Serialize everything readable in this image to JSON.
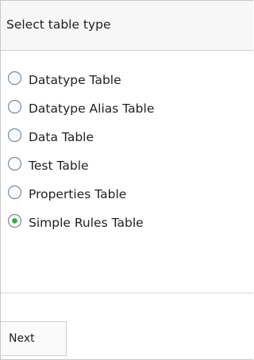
{
  "header": {
    "title": "Select table type"
  },
  "options": [
    {
      "label": "Datatype Table",
      "selected": false
    },
    {
      "label": "Datatype Alias Table",
      "selected": false
    },
    {
      "label": "Data Table",
      "selected": false
    },
    {
      "label": "Test Table",
      "selected": false
    },
    {
      "label": "Properties Table",
      "selected": false
    },
    {
      "label": "Simple Rules Table",
      "selected": true
    }
  ],
  "footer": {
    "next_label": "Next"
  },
  "colors": {
    "radio_border": "#7a8a99",
    "radio_dot": "#2fae3e"
  }
}
